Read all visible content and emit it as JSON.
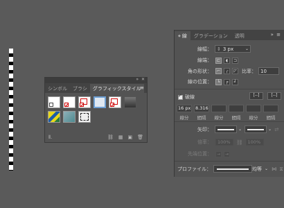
{
  "graphic_panel": {
    "tabs": [
      {
        "label": "シンボル",
        "active": false
      },
      {
        "label": "ブラシ",
        "active": false
      },
      {
        "label": "グラフィックスタイル",
        "active": true
      }
    ],
    "collapse_icon": "double-chevron-icon",
    "close_icon": "close-icon",
    "menu_icon": "hamburger-menu-icon"
  },
  "stroke_panel": {
    "tabs": [
      {
        "label": "線",
        "active": true
      },
      {
        "label": "グラデーション",
        "active": false
      },
      {
        "label": "透明",
        "active": false
      }
    ],
    "weight_label": "線幅：",
    "weight_value": "3 px",
    "cap_label": "線端：",
    "corner_label": "角の形状：",
    "miter_label": "比率：",
    "miter_value": "10",
    "align_label": "線の位置：",
    "dashed_label": "破線",
    "dashed_checked": true,
    "dash_values": [
      "16 px",
      "8.316",
      "",
      "",
      "",
      ""
    ],
    "dash_labels": [
      "線分",
      "間隔",
      "線分",
      "間隔",
      "線分",
      "間隔"
    ],
    "arrow_label": "矢印：",
    "scale_label": "倍率：",
    "scale_values": [
      "100%",
      "100%"
    ],
    "arrow_pos_label": "先端位置：",
    "profile_label": "プロファイル：",
    "profile_value": "均等"
  }
}
